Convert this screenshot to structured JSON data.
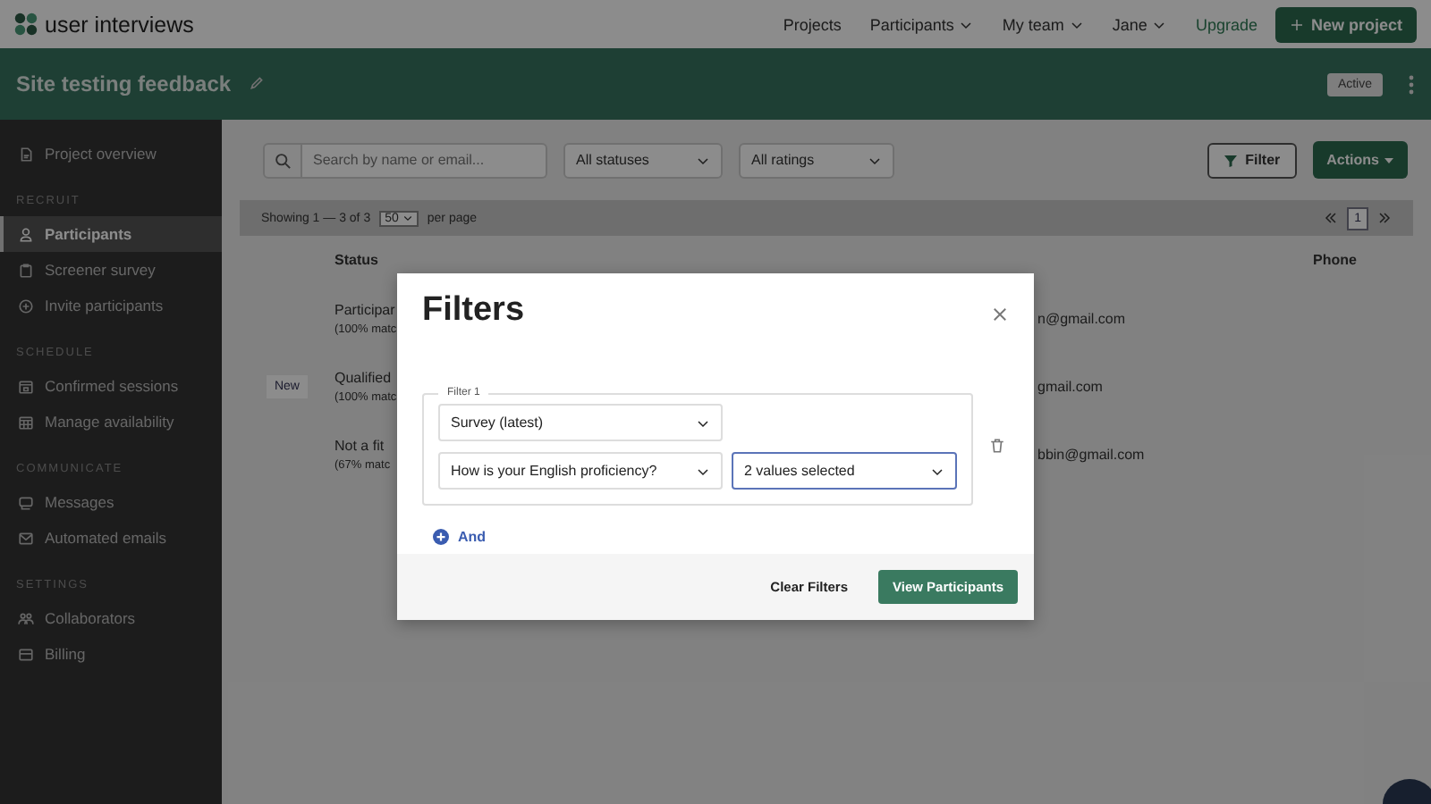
{
  "nav": {
    "brand": "user interviews",
    "items": [
      {
        "label": "Projects",
        "dropdown": false
      },
      {
        "label": "Participants",
        "dropdown": true
      },
      {
        "label": "My team",
        "dropdown": true
      },
      {
        "label": "Jane",
        "dropdown": true
      }
    ],
    "upgrade": "Upgrade",
    "new_project": "New project"
  },
  "project": {
    "title": "Site testing feedback",
    "status": "Active"
  },
  "sidebar": {
    "sections": [
      {
        "items": [
          {
            "label": "Project overview",
            "kind": "doc",
            "selected": false
          }
        ]
      },
      {
        "heading": "RECRUIT",
        "items": [
          {
            "label": "Participants",
            "kind": "person",
            "selected": true
          },
          {
            "label": "Screener survey",
            "kind": "clipboard",
            "selected": false
          },
          {
            "label": "Invite participants",
            "kind": "plus",
            "selected": false
          }
        ]
      },
      {
        "heading": "SCHEDULE",
        "items": [
          {
            "label": "Confirmed sessions",
            "kind": "calendar",
            "selected": false
          },
          {
            "label": "Manage availability",
            "kind": "grid",
            "selected": false
          }
        ]
      },
      {
        "heading": "COMMUNICATE",
        "items": [
          {
            "label": "Messages",
            "kind": "chat",
            "selected": false
          },
          {
            "label": "Automated emails",
            "kind": "mail",
            "selected": false
          }
        ]
      },
      {
        "heading": "SETTINGS",
        "items": [
          {
            "label": "Collaborators",
            "kind": "people",
            "selected": false
          },
          {
            "label": "Billing",
            "kind": "card",
            "selected": false
          }
        ]
      }
    ]
  },
  "toolbar": {
    "search": {
      "placeholder": "Search by name or email..."
    },
    "status_filter": "All statuses",
    "rating_filter": "All ratings",
    "filter_button": "Filter",
    "actions_button": "Actions"
  },
  "pager": {
    "summary": "Showing 1 — 3 of 3",
    "per_page": "50",
    "per_page_label": "per page",
    "page": "1"
  },
  "table": {
    "columns": [
      {
        "label": "Status"
      },
      {
        "label": "Phone"
      }
    ],
    "rows": [
      {
        "status": "Participar",
        "match": "(100% matc",
        "email": "n@gmail.com"
      },
      {
        "badge": "New",
        "status": "Qualified",
        "match": "(100% matc",
        "email": "gmail.com"
      },
      {
        "status": "Not a fit",
        "match": "(67% matc",
        "email": "bbin@gmail.com"
      }
    ]
  },
  "modal": {
    "title": "Filters",
    "group": {
      "legend": "Filter 1",
      "field": "Survey (latest)",
      "question": "How is your English proficiency?",
      "values": "2 values selected"
    },
    "and_button": "And",
    "clear_button": "Clear Filters",
    "submit_button": "View Participants"
  }
}
